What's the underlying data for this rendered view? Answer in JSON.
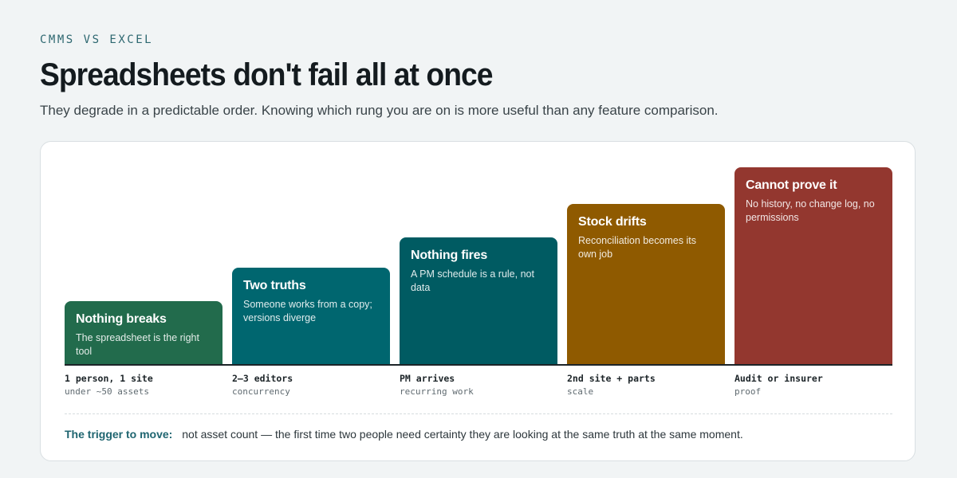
{
  "header": {
    "eyebrow": "CMMS VS EXCEL",
    "title": "Spreadsheets don't fail all at once",
    "subtitle": "They degrade in a predictable order. Knowing which rung you are on is more useful than any feature comparison."
  },
  "rungs": [
    {
      "title": "Nothing breaks",
      "desc": "The spreadsheet is the right tool",
      "label": "1 person, 1 site",
      "sublabel": "under ~50 assets",
      "color": "#226b4c"
    },
    {
      "title": "Two truths",
      "desc": "Someone works from a copy; versions diverge",
      "label": "2–3 editors",
      "sublabel": "concurrency",
      "color": "#00666f"
    },
    {
      "title": "Nothing fires",
      "desc": "A PM schedule is a rule, not data",
      "label": "PM arrives",
      "sublabel": "recurring work",
      "color": "#005b62"
    },
    {
      "title": "Stock drifts",
      "desc": "Reconciliation becomes its own job",
      "label": "2nd site + parts",
      "sublabel": "scale",
      "color": "#8f5a00"
    },
    {
      "title": "Cannot prove it",
      "desc": "No history, no change log, no permissions",
      "label": "Audit or insurer",
      "sublabel": "proof",
      "color": "#93372f"
    }
  ],
  "footer": {
    "trigger_label": "The trigger to move:",
    "trigger_text": "not asset count — the first time two people need certainty they are looking at the same truth at the same moment."
  }
}
